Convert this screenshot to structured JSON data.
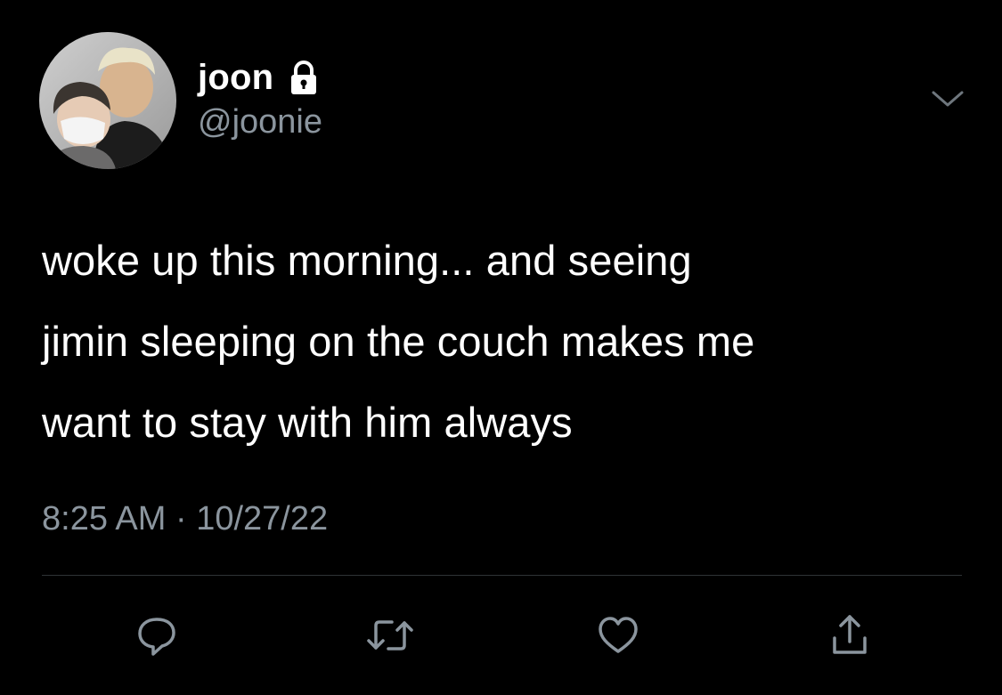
{
  "user": {
    "display_name": "joon",
    "handle": "@joonie",
    "protected_icon": "lock-icon",
    "avatar": "profile-photo"
  },
  "tweet": {
    "lines": [
      "woke up this morning... and seeing",
      "jimin sleeping on the couch makes me",
      "want to stay with him always"
    ],
    "time": "8:25 AM",
    "separator": "·",
    "date": "10/27/22"
  },
  "actions": [
    {
      "name": "reply",
      "icon": "reply-icon"
    },
    {
      "name": "retweet",
      "icon": "retweet-icon"
    },
    {
      "name": "like",
      "icon": "heart-icon"
    },
    {
      "name": "share",
      "icon": "share-icon"
    }
  ],
  "colors": {
    "background": "#000000",
    "text": "#ffffff",
    "secondary": "#8b959e",
    "divider": "#2f3336"
  }
}
